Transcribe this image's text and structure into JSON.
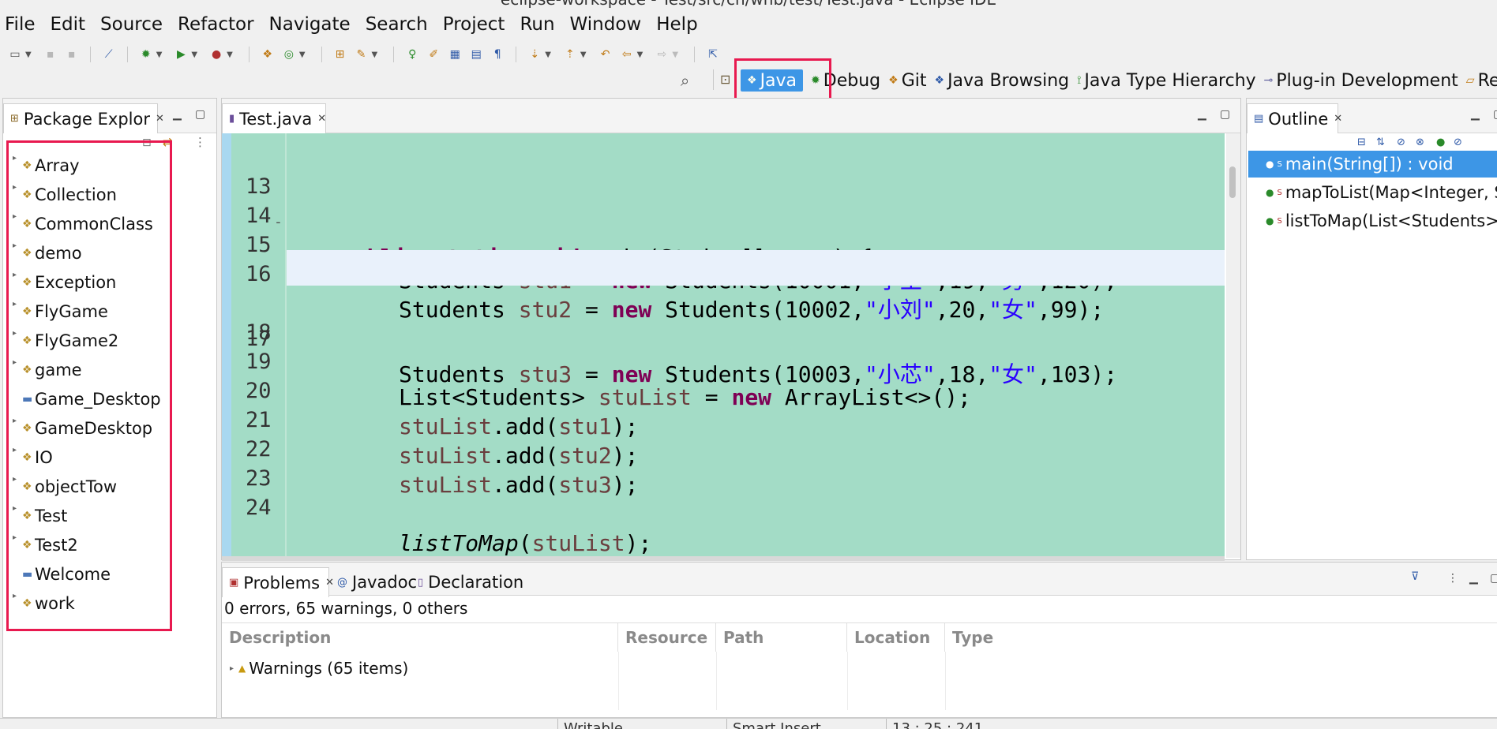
{
  "window": {
    "title": "eclipse-workspace - Test/src/cn/whb/test/Test.java - Eclipse IDE"
  },
  "menu": [
    "File",
    "Edit",
    "Source",
    "Refactor",
    "Navigate",
    "Search",
    "Project",
    "Run",
    "Window",
    "Help"
  ],
  "perspectives": [
    {
      "label": "Java",
      "active": true
    },
    {
      "label": "Debug",
      "active": false
    },
    {
      "label": "Git",
      "active": false
    },
    {
      "label": "Java Browsing",
      "active": false
    },
    {
      "label": "Java Type Hierarchy",
      "active": false
    },
    {
      "label": "Plug-in Development",
      "active": false
    },
    {
      "label": "Resource",
      "active": false
    }
  ],
  "package_explorer": {
    "tab_label": "Package Explor",
    "projects": [
      "Array",
      "Collection",
      "CommonClass",
      "demo",
      "Exception",
      "FlyGame",
      "FlyGame2",
      "game",
      "Game_Desktop",
      "GameDesktop",
      "IO",
      "objectTow",
      "Test",
      "Test2",
      "Welcome",
      "work"
    ]
  },
  "editor": {
    "tab_label": "Test.java",
    "lines": [
      {
        "n": "13",
        "fold": "-"
      },
      {
        "n": "14"
      },
      {
        "n": "15"
      },
      {
        "n": "16"
      },
      {
        "n": "17",
        "current": true
      },
      {
        "n": "18"
      },
      {
        "n": "19"
      },
      {
        "n": "20"
      },
      {
        "n": "21"
      },
      {
        "n": "22"
      },
      {
        "n": "23"
      },
      {
        "n": "24"
      }
    ],
    "code": {
      "l13": {
        "kw1": "public",
        "kw2": "static",
        "kw3": "void",
        "rest": " main(String[] ",
        "param": "args",
        "end": ") {"
      },
      "l15": {
        "type": "Students ",
        "var": "stu1",
        "eq": " = ",
        "kw": "new",
        "call": " Students(10001,",
        "s1": "\"小王\"",
        "mid": ",19,",
        "s2": "\"男\"",
        "end": ",120);"
      },
      "l16": {
        "type": "Students ",
        "var": "stu2",
        "eq": " = ",
        "kw": "new",
        "call": " Students(10002,",
        "s1": "\"小刘\"",
        "mid": ",20,",
        "s2": "\"女\"",
        "end": ",99);"
      },
      "l17": {
        "type": "Students ",
        "var": "stu3",
        "eq": " = ",
        "kw": "new",
        "call": " Students(10003,",
        "s1": "\"小芯\"",
        "mid": ",18,",
        "s2": "\"女\"",
        "end": ",103);"
      },
      "l19": {
        "type": "List<Students> ",
        "var": "stuList",
        "eq": " = ",
        "kw": "new",
        "end": " ArrayList<>();"
      },
      "l20": {
        "obj": "stuList",
        "call": ".add(",
        "arg": "stu1",
        "end": ");"
      },
      "l21": {
        "obj": "stuList",
        "call": ".add(",
        "arg": "stu2",
        "end": ");"
      },
      "l22": {
        "obj": "stuList",
        "call": ".add(",
        "arg": "stu3",
        "end": ");"
      },
      "l24": {
        "fn": "listToMap",
        "open": "(",
        "arg": "stuList",
        "end": ");"
      }
    }
  },
  "outline": {
    "tab_label": "Outline",
    "items": [
      {
        "label": "main(String[]) : void",
        "selected": true
      },
      {
        "label": "mapToList(Map<Integer, Stud"
      },
      {
        "label": "listToMap(List<Students>) : vo"
      }
    ]
  },
  "problems": {
    "tabs": [
      "Problems",
      "Javadoc",
      "Declaration"
    ],
    "summary": "0 errors, 65 warnings, 0 others",
    "columns": [
      "Description",
      "Resource",
      "Path",
      "Location",
      "Type"
    ],
    "rows": [
      {
        "label": "Warnings (65 items)"
      }
    ]
  },
  "status": {
    "writable": "Writable",
    "insert": "Smart Insert",
    "position": "13 : 25 : 241"
  }
}
